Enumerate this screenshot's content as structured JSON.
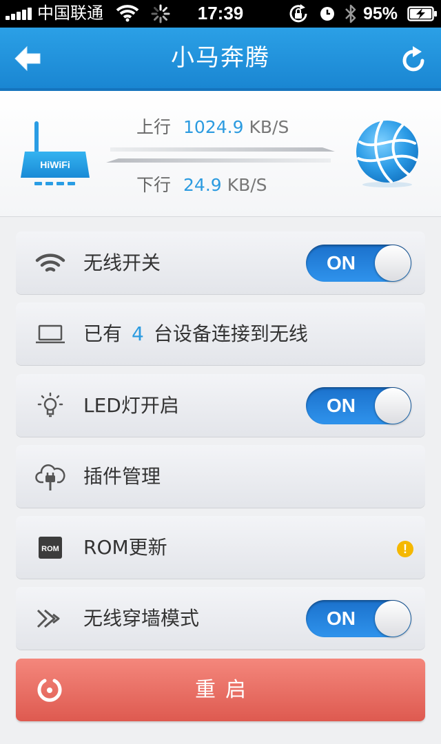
{
  "status_bar": {
    "carrier": "中国联通",
    "time": "17:39",
    "battery": "95%",
    "icons": [
      "signal-icon",
      "wifi-icon",
      "activity-spinner-icon",
      "rotation-lock-icon",
      "alarm-icon",
      "bluetooth-icon",
      "battery-charging-icon"
    ]
  },
  "nav": {
    "title": "小马奔腾",
    "back_icon": "back-arrow-icon",
    "refresh_icon": "refresh-icon"
  },
  "traffic": {
    "router_label": "HiWiFi",
    "upload": {
      "label": "上行",
      "value": "1024.9",
      "unit": "KB/S"
    },
    "download": {
      "label": "下行",
      "value": "24.9",
      "unit": "KB/S"
    }
  },
  "items": {
    "wireless": {
      "label": "无线开关",
      "toggle": "ON",
      "icon": "wifi-icon"
    },
    "devices": {
      "prefix": "已有",
      "count": "4",
      "suffix": "台设备连接到无线",
      "icon": "laptop-icon"
    },
    "led": {
      "label": "LED灯开启",
      "toggle": "ON",
      "icon": "lightbulb-icon"
    },
    "plugins": {
      "label": "插件管理",
      "icon": "cloud-plug-icon"
    },
    "rom": {
      "label": "ROM更新",
      "chip_text": "ROM",
      "badge": "!",
      "icon": "rom-chip-icon"
    },
    "wall_mode": {
      "label": "无线穿墙模式",
      "toggle": "ON",
      "icon": "double-chevron-icon"
    }
  },
  "reboot": {
    "label": "重启",
    "icon": "power-icon"
  },
  "colors": {
    "accent": "#2c9be0",
    "navbar": "#1f8fd9",
    "toggle_on": "#2383dc",
    "reboot": "#e8675d",
    "warning": "#f5b800"
  }
}
